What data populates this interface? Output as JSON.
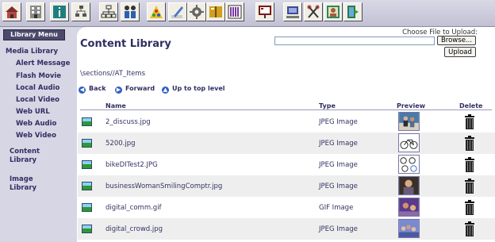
{
  "toolbar": {
    "icons": [
      "home-icon",
      "building-icon",
      "info-icon",
      "hierarchy-icon",
      "org-chart-icon",
      "people-icon",
      "pyramid-icon",
      "pencil-icon",
      "settings-icon",
      "book-icon",
      "library-icon",
      "presentation-icon",
      "computer-icon",
      "tools-icon",
      "portrait-icon",
      "exit-icon"
    ]
  },
  "sidebar": {
    "header": "Library Menu",
    "items": [
      {
        "label": "Media Library"
      },
      {
        "label": "Alert Message"
      },
      {
        "label": "Flash Movie"
      },
      {
        "label": "Local Audio"
      },
      {
        "label": "Local Video"
      },
      {
        "label": "Web URL"
      },
      {
        "label": "Web Audio"
      },
      {
        "label": "Web Video"
      },
      {
        "label": "Content Library"
      },
      {
        "label": "Image Library"
      }
    ],
    "content_library_line1": "Content",
    "content_library_line2": "Library",
    "image_library_line1": "Image",
    "image_library_line2": "Library"
  },
  "main": {
    "title": "Content Library",
    "upload": {
      "label": "Choose File to Upload:",
      "path_value": "",
      "browse_label": "Browse...",
      "upload_label": "Upload"
    },
    "path": "\\sections//AT_Items",
    "nav": {
      "back": "Back",
      "forward": "Forward",
      "up": "Up to top level"
    },
    "columns": {
      "name": "Name",
      "type": "Type",
      "preview": "Preview",
      "delete": "Delete"
    },
    "files": [
      {
        "name": "2_discuss.jpg",
        "type": "JPEG Image",
        "preview": "discussion-photo"
      },
      {
        "name": "5200.jpg",
        "type": "JPEG Image",
        "preview": "bicycle-photo"
      },
      {
        "name": "bikeDITest2.JPG",
        "type": "JPEG Image",
        "preview": "bicycles-photo"
      },
      {
        "name": "businessWomanSmilingComptr.jpg",
        "type": "JPEG Image",
        "preview": "businesswoman-photo"
      },
      {
        "name": "digital_comm.gif",
        "type": "GIF Image",
        "preview": "digital-comm-photo"
      },
      {
        "name": "digital_crowd.jpg",
        "type": "JPEG Image",
        "preview": "digital-crowd-photo"
      }
    ]
  },
  "colors": {
    "accent": "#2f2e63",
    "sidebar_bg": "#d7d6e4",
    "row_alt": "#eeeeee"
  }
}
